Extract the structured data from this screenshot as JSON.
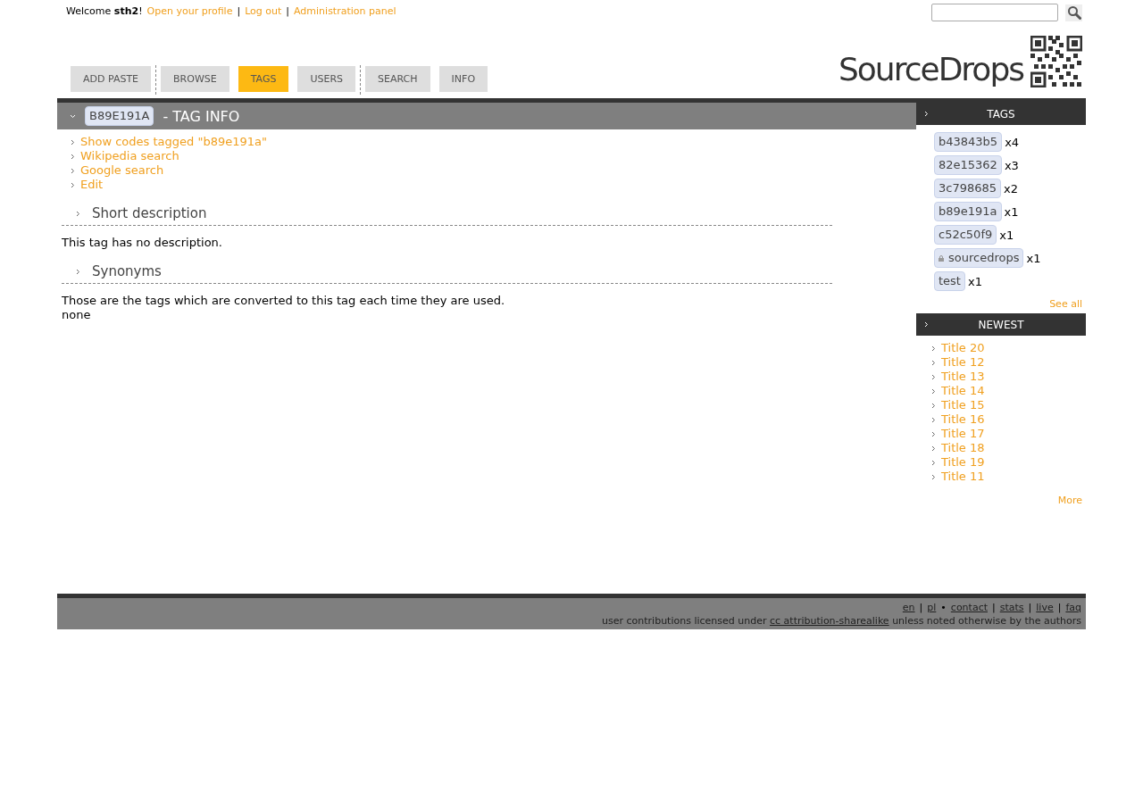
{
  "userbar": {
    "welcome": "Welcome **sth2**!",
    "links": [
      {
        "kind": "link",
        "text": "Open your profile"
      },
      {
        "kind": "sep",
        "text": "|"
      },
      {
        "kind": "link",
        "text": "Log out"
      },
      {
        "kind": "sep",
        "text": "|"
      },
      {
        "kind": "link",
        "text": "Administration panel"
      }
    ]
  },
  "logo": {
    "text": "SourceDrops"
  },
  "tabs": [
    {
      "label": "ADD PASTE",
      "selected": false,
      "divider_after": true
    },
    {
      "label": "BROWSE",
      "selected": false,
      "divider_after": false
    },
    {
      "label": "TAGS",
      "selected": true,
      "divider_after": false
    },
    {
      "label": "USERS",
      "selected": false,
      "divider_after": true
    },
    {
      "label": "SEARCH",
      "selected": false,
      "divider_after": false
    },
    {
      "label": "INFO",
      "selected": false,
      "divider_after": false
    }
  ],
  "main": {
    "tag": "B89E191A",
    "title": "- TAG INFO",
    "actions": [
      "Show codes tagged \"b89e191a\"",
      "Wikipedia search",
      "Google search",
      "Edit"
    ],
    "sections": [
      {
        "heading": "Short description",
        "lines": [
          "This tag has no description."
        ]
      },
      {
        "heading": "Synonyms",
        "lines": [
          "Those are the tags which are converted to this tag each time they are used.",
          "none"
        ]
      }
    ]
  },
  "sidebar": {
    "tags_box": {
      "title": "TAGS",
      "tags": [
        {
          "name": "b43843b5",
          "count": "x4",
          "locked": false
        },
        {
          "name": "82e15362",
          "count": "x3",
          "locked": false
        },
        {
          "name": "3c798685",
          "count": "x2",
          "locked": false
        },
        {
          "name": "b89e191a",
          "count": "x1",
          "locked": false
        },
        {
          "name": "c52c50f9",
          "count": "x1",
          "locked": false
        },
        {
          "name": "sourcedrops",
          "count": "x1",
          "locked": true
        },
        {
          "name": "test",
          "count": "x1",
          "locked": false
        }
      ],
      "more": "See all"
    },
    "newest_box": {
      "title": "NEWEST",
      "items": [
        "Title 20",
        "Title 12",
        "Title 13",
        "Title 14",
        "Title 15",
        "Title 16",
        "Title 17",
        "Title 18",
        "Title 19",
        "Title 11"
      ],
      "more": "More"
    }
  },
  "footer": {
    "links": [
      {
        "kind": "link",
        "text": "en"
      },
      {
        "kind": "sep",
        "text": "|"
      },
      {
        "kind": "link",
        "text": "pl"
      },
      {
        "kind": "sep",
        "text": "•"
      },
      {
        "kind": "link",
        "text": "contact"
      },
      {
        "kind": "sep",
        "text": "|"
      },
      {
        "kind": "link",
        "text": "stats"
      },
      {
        "kind": "sep",
        "text": "|"
      },
      {
        "kind": "link",
        "text": "live"
      },
      {
        "kind": "sep",
        "text": "|"
      },
      {
        "kind": "link",
        "text": "faq"
      }
    ],
    "license": {
      "before": "user contributions licensed under",
      "link": "cc attribution-sharealike",
      "after": "unless noted otherwise by the authors"
    }
  }
}
